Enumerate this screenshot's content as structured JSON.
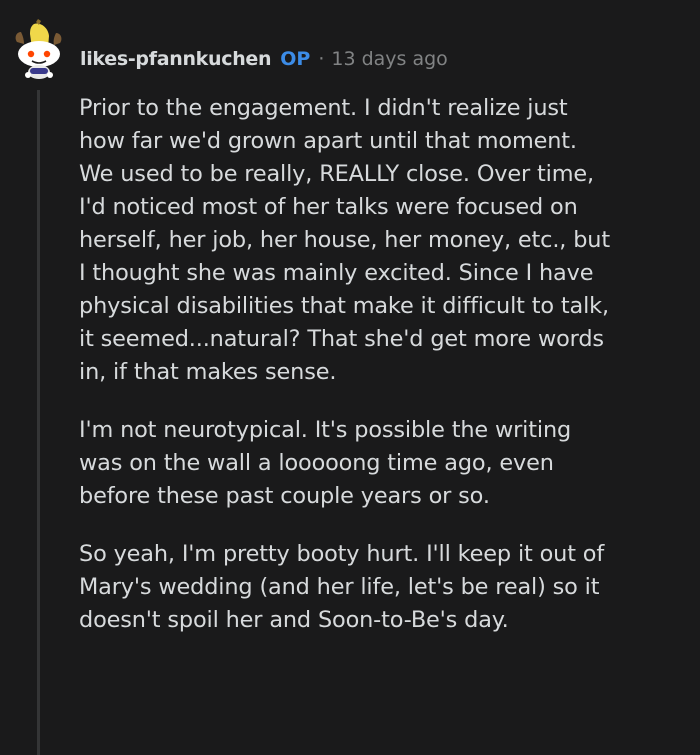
{
  "comment": {
    "author": "likes-pfannkuchen",
    "op_badge": "OP",
    "separator": "·",
    "timestamp": "13 days ago",
    "avatar_icon": "snoo-banana-avatar-icon",
    "paragraphs": [
      {
        "lines": [
          "Prior to the engagement. I didn't realize just",
          "how far we'd grown apart until that moment.",
          "We used to be really, REALLY close. Over time,",
          "I'd noticed most of her talks were focused on",
          "herself, her job, her house, her money, etc., but",
          "I thought she was mainly excited. Since I have",
          "physical disabilities that make it difficult to talk,",
          "it seemed...natural? That she'd get more words",
          "in, if that makes sense."
        ]
      },
      {
        "lines": [
          "I'm not neurotypical. It's possible the writing",
          "was on the wall a looooong time ago, even",
          "before these past couple years or so."
        ]
      },
      {
        "lines": [
          "So yeah, I'm pretty booty hurt. I'll keep it out of",
          "Mary's wedding (and her life, let's be real) so it",
          "doesn't spoil her and Soon-to-Be's day."
        ]
      }
    ]
  },
  "colors": {
    "background": "#1a1a1b",
    "text": "#d7dadc",
    "muted": "#818384",
    "op_blue": "#3c8ce7",
    "thread_line": "#343536"
  }
}
